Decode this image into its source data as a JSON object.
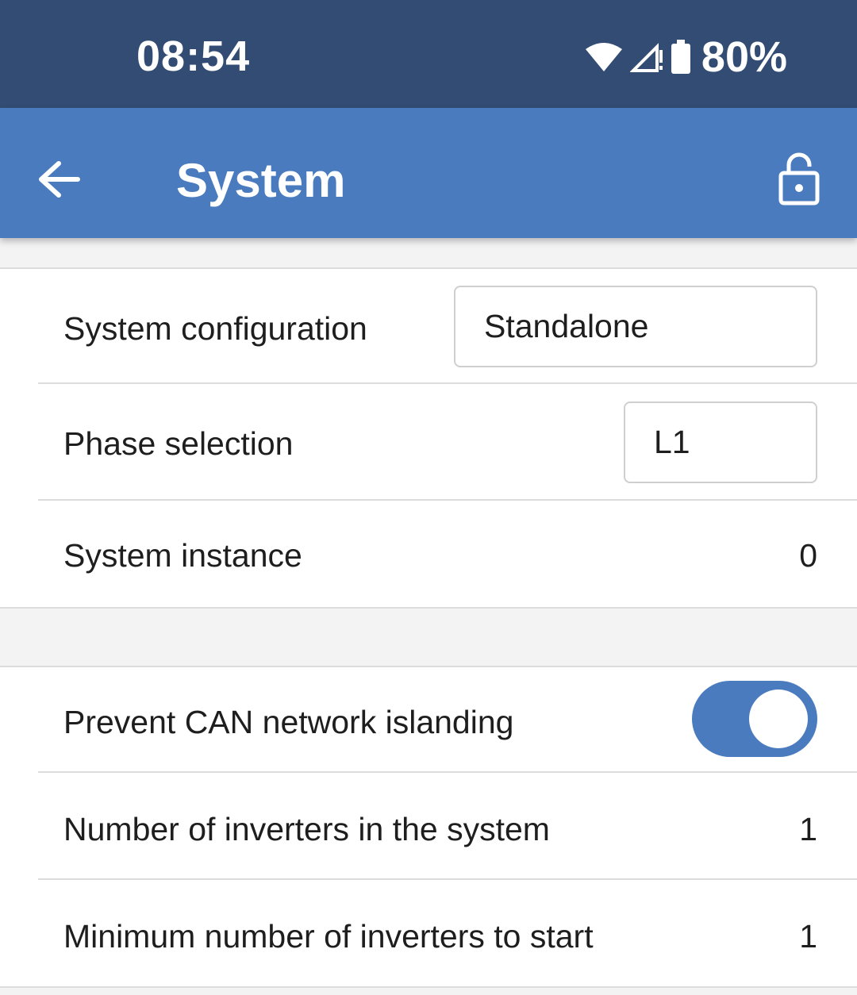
{
  "status_bar": {
    "time": "08:54",
    "battery": "80%",
    "icons": [
      "wifi-icon",
      "cell-signal-icon",
      "battery-icon"
    ]
  },
  "app_bar": {
    "title": "System",
    "icons": [
      "back-arrow-icon",
      "lock-icon"
    ]
  },
  "section1": {
    "system_configuration": {
      "label": "System configuration",
      "value": "Standalone"
    },
    "phase_selection": {
      "label": "Phase selection",
      "value": "L1"
    },
    "system_instance": {
      "label": "System instance",
      "value": "0"
    }
  },
  "section2": {
    "prevent_can": {
      "label": "Prevent CAN network islanding",
      "enabled": true
    },
    "num_inverters": {
      "label": "Number of inverters in the system",
      "value": "1"
    },
    "min_inverters": {
      "label": "Minimum number of inverters to start",
      "value": "1"
    }
  },
  "colors": {
    "status_bar": "#324c73",
    "app_bar": "#4a7bbf",
    "toggle_on": "#4a7bbf"
  }
}
